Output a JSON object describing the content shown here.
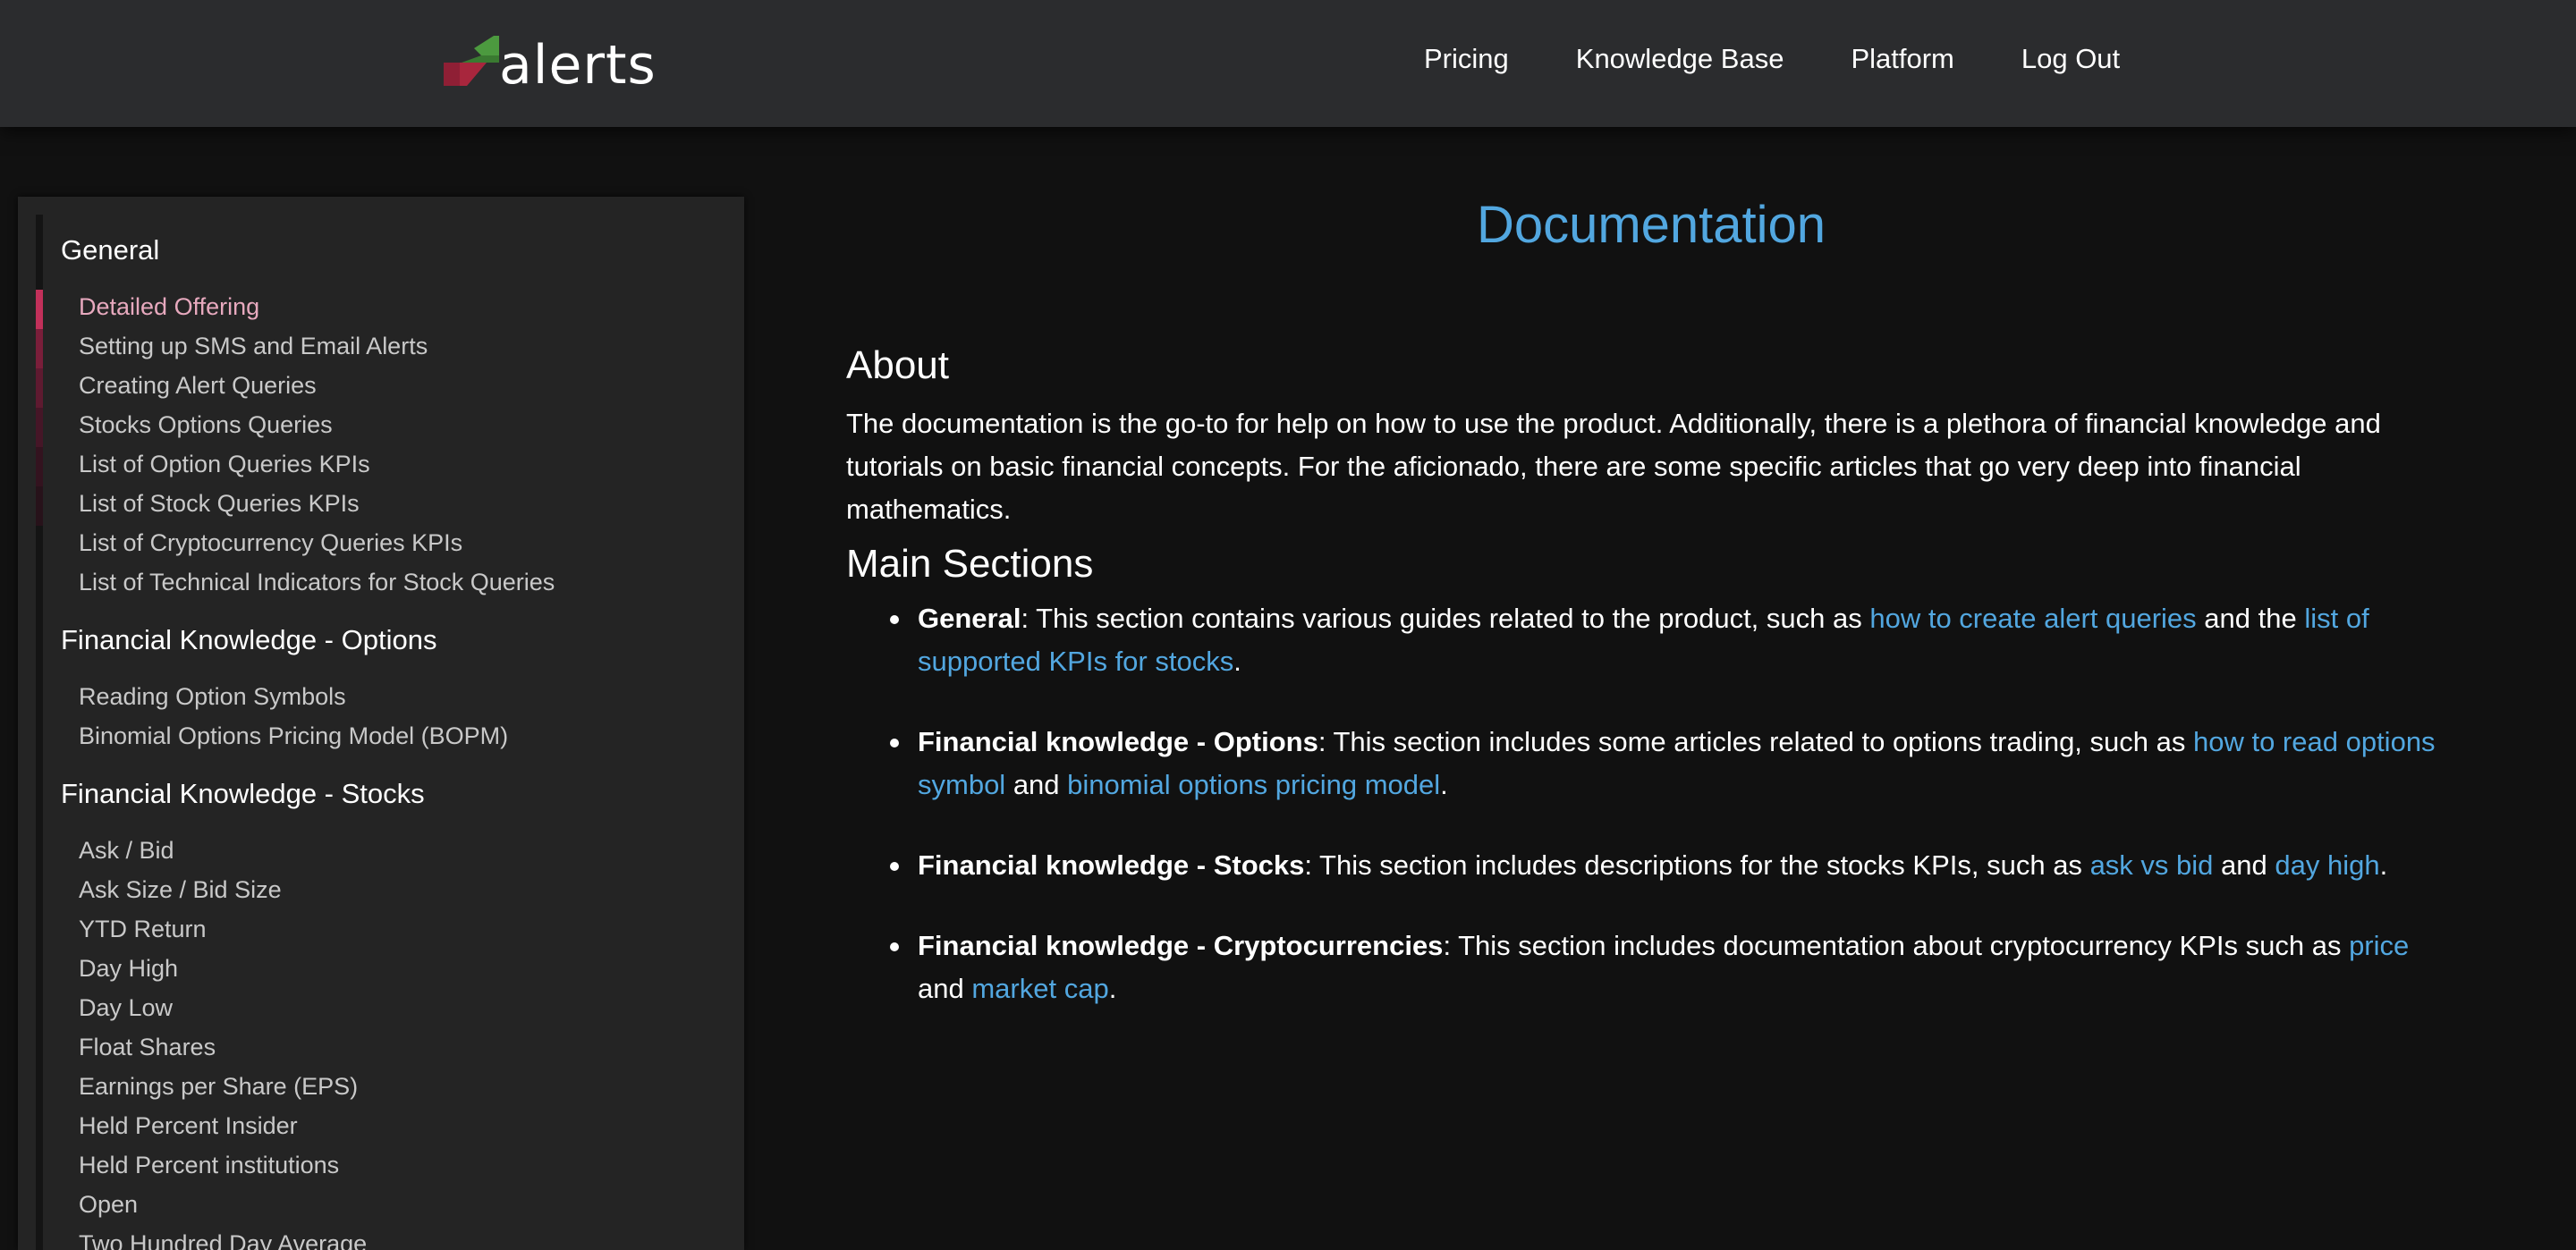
{
  "header": {
    "logo_text": "alerts",
    "nav": [
      "Pricing",
      "Knowledge Base",
      "Platform",
      "Log Out"
    ]
  },
  "sidebar": {
    "sections": [
      {
        "title": "General",
        "items": [
          "Detailed Offering",
          "Setting up SMS and Email Alerts",
          "Creating Alert Queries",
          "Stocks Options Queries",
          "List of Option Queries KPIs",
          "List of Stock Queries KPIs",
          "List of Cryptocurrency Queries KPIs",
          "List of Technical Indicators for Stock Queries"
        ]
      },
      {
        "title": "Financial Knowledge - Options",
        "items": [
          "Reading Option Symbols",
          "Binomial Options Pricing Model (BOPM)"
        ]
      },
      {
        "title": "Financial Knowledge - Stocks",
        "items": [
          "Ask / Bid",
          "Ask Size / Bid Size",
          "YTD Return",
          "Day High",
          "Day Low",
          "Float Shares",
          "Earnings per Share (EPS)",
          "Held Percent Insider",
          "Held Percent institutions",
          "Open",
          "Two Hundred Day Average"
        ]
      }
    ],
    "active_item": "Detailed Offering"
  },
  "main": {
    "title": "Documentation",
    "about": {
      "heading": "About",
      "text": "The documentation is the go-to for help on how to use the product. Additionally, there is a plethora of financial knowledge and tutorials on basic financial concepts. For the aficionado, there are some specific articles that go very deep into financial mathematics."
    },
    "main_sections": {
      "heading": "Main Sections",
      "bullets": [
        {
          "bold": "General",
          "text1": ": This section contains various guides related to the product, such as ",
          "link1": "how to create alert queries",
          "text2": " and the ",
          "link2": "list of supported KPIs for stocks",
          "text3": "."
        },
        {
          "bold": "Financial knowledge - Options",
          "text1": ": This section includes some articles related to options trading, such as ",
          "link1": "how to read options symbol",
          "text2": " and ",
          "link2": "binomial options pricing model",
          "text3": "."
        },
        {
          "bold": "Financial knowledge - Stocks",
          "text1": ": This section includes descriptions for the stocks KPIs, such as ",
          "link1": "ask vs bid",
          "text2": " and ",
          "link2": "day high",
          "text3": "."
        },
        {
          "bold": "Financial knowledge - Cryptocurrencies",
          "text1": ": This section includes documentation about cryptocurrency KPIs such as ",
          "link1": "price",
          "text2": " and ",
          "link2": "market cap",
          "text3": "."
        }
      ]
    }
  },
  "colors": {
    "header_bg": "#2b2c2e",
    "page_bg": "#111111",
    "sidebar_bg": "#242424",
    "link": "#52a7e0",
    "active_item": "#e7a9be",
    "logo_green": "#3f8a3a",
    "logo_red": "#a8263d"
  }
}
